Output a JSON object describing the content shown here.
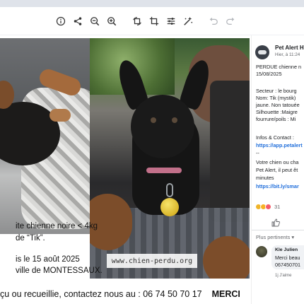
{
  "toolbar": {
    "icons": [
      "info-icon",
      "share-icon",
      "zoom-out-icon",
      "zoom-in-icon",
      "rotate-icon",
      "crop-icon",
      "adjust-icon",
      "magic-icon",
      "undo-icon",
      "redo-icon"
    ]
  },
  "poster": {
    "line1": "ite chienne noire < 4kg",
    "line2": "de “Tik”.",
    "line3": "is le 15 août 2025",
    "line4": "ville de MONTESSAUX.",
    "contact": "çu ou recueillie, contactez nous au : 06 74 50 70 17",
    "merci": "MERCI",
    "watermark": "www.chien-perdu.org"
  },
  "post": {
    "author": "Pet Alert H",
    "date": "Hier, à 11:24",
    "lines": [
      "PERDUE chienne n",
      "15/08/2025",
      "",
      "Secteur : le bourg",
      "Nom: Tik (mystik)",
      "jaune. Non tatouée",
      "Silhouette :Maigre",
      "fourrure/poils : Mi"
    ],
    "infos": "Infos & Contact :",
    "link1": "https://app.petalert",
    "dashes": "--",
    "lines2": [
      "Votre chien ou cha",
      "Pet Alert, il peut êt",
      "minutes"
    ],
    "link2": "https://bit.ly/smar",
    "reactions_count": "31",
    "sort": "Plus pertinents",
    "comment": {
      "name": "Kle Julien",
      "line1": "Merci beau",
      "line2": "067450701",
      "meta": "1j    J'aime"
    }
  },
  "colors": {
    "link": "#216fdb",
    "toolbar_bg": "#ffffff",
    "topbar": "#dfe3ea"
  }
}
